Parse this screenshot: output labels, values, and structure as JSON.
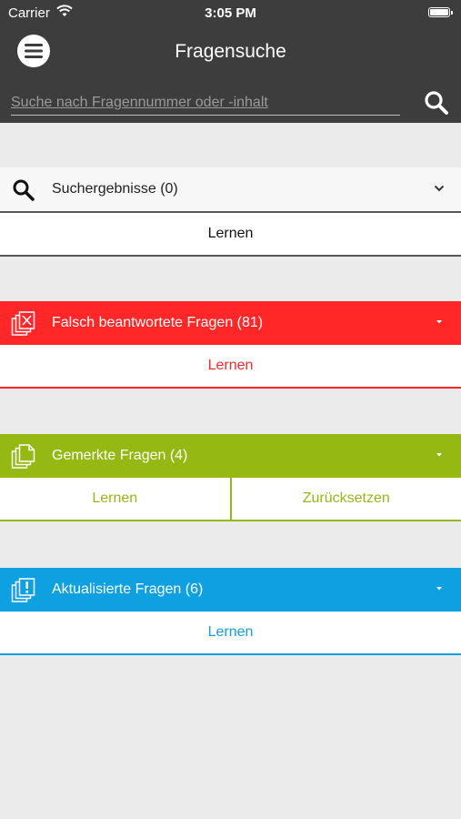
{
  "status": {
    "carrier": "Carrier",
    "time": "3:05 PM"
  },
  "appbar": {
    "title": "Fragensuche",
    "search_placeholder": "Suche nach Fragennummer oder -inhalt"
  },
  "colors": {
    "appbar": "#3d3d3d",
    "background": "#ebebeb",
    "red": "#ff2727",
    "green": "#95b812",
    "blue": "#0ea0e0"
  },
  "sections": [
    {
      "label": "Suchergebnisse (0)",
      "icon": "search-icon",
      "buttons": [
        "Lernen"
      ]
    },
    {
      "label": "Falsch beantwortete Fragen (81)",
      "icon": "wrong-answers-icon",
      "buttons": [
        "Lernen"
      ]
    },
    {
      "label": "Gemerkte Fragen (4)",
      "icon": "bookmarked-questions-icon",
      "buttons": [
        "Lernen",
        "Zurücksetzen"
      ]
    },
    {
      "label": "Aktualisierte Fragen (6)",
      "icon": "updated-questions-icon",
      "buttons": [
        "Lernen"
      ]
    }
  ]
}
